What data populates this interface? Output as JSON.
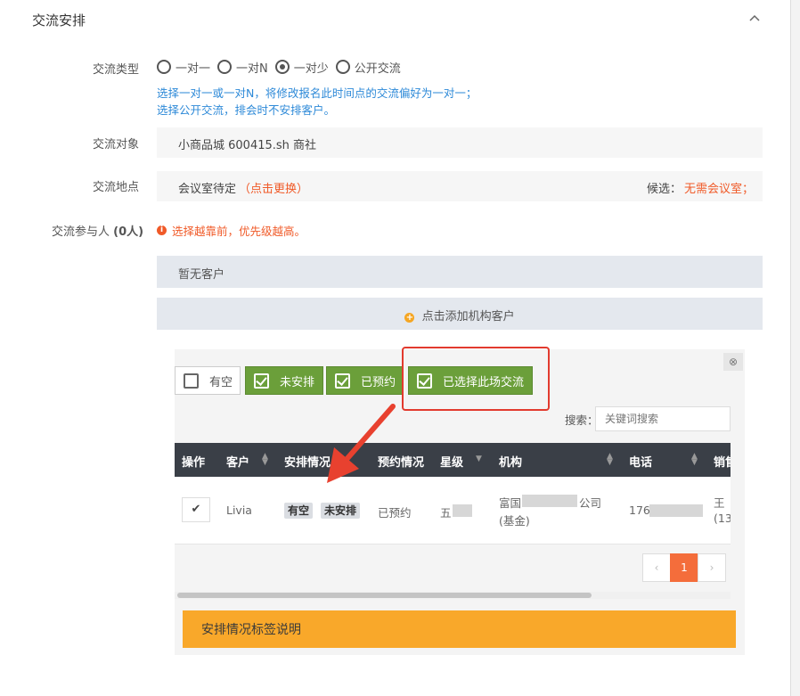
{
  "section": {
    "title": "交流安排"
  },
  "form": {
    "type_label": "交流类型",
    "radio_options": [
      {
        "label": "一对一",
        "selected": false
      },
      {
        "label": "一对N",
        "selected": false
      },
      {
        "label": "一对少",
        "selected": true
      },
      {
        "label": "公开交流",
        "selected": false
      }
    ],
    "hint_line1": "选择一对一或一对N，将修改报名此时间点的交流偏好为一对一；",
    "hint_line2": "选择公开交流，排会时不安排客户。",
    "target_label": "交流对象",
    "target_value": "小商品城 600415.sh 商社",
    "location_label": "交流地点",
    "location_value": "会议室待定",
    "location_change": "（点击更换）",
    "candidate_label": "候选：",
    "candidate_value": "无需会议室；",
    "participants_label": "交流参与人",
    "participants_count": "(0人)",
    "warning": "选择越靠前，优先级越高。",
    "no_customer": "暂无客户",
    "add_customer": "点击添加机构客户"
  },
  "filters": [
    {
      "label": "有空",
      "checked": false
    },
    {
      "label": "未安排",
      "checked": true
    },
    {
      "label": "已预约",
      "checked": true
    },
    {
      "label": "已选择此场交流",
      "checked": true
    }
  ],
  "search": {
    "label": "搜索：",
    "placeholder": "关键词搜索"
  },
  "table": {
    "headers": [
      "操作",
      "客户",
      "安排情况",
      "预约情况",
      "星级",
      "机构",
      "电话",
      "销售"
    ],
    "row": {
      "customer": "Livia",
      "tags": [
        "有空",
        "未安排"
      ],
      "booking": "已预约",
      "star": "五",
      "institution_line1": "富国",
      "institution_line1_tail": "公司",
      "institution_line2": "(基金)",
      "phone": "176",
      "sales_line1": "王",
      "sales_line2": "(13"
    }
  },
  "pagination": {
    "prev": "‹",
    "current": "1",
    "next": "›"
  },
  "legend": {
    "label": "安排情况标签说明"
  },
  "colors": {
    "accent_green": "#6b9f3a",
    "orange": "#f9a82a",
    "warn": "#f05a28",
    "hint_blue": "#2e8ad8",
    "annotation_red": "#e23a2e"
  }
}
